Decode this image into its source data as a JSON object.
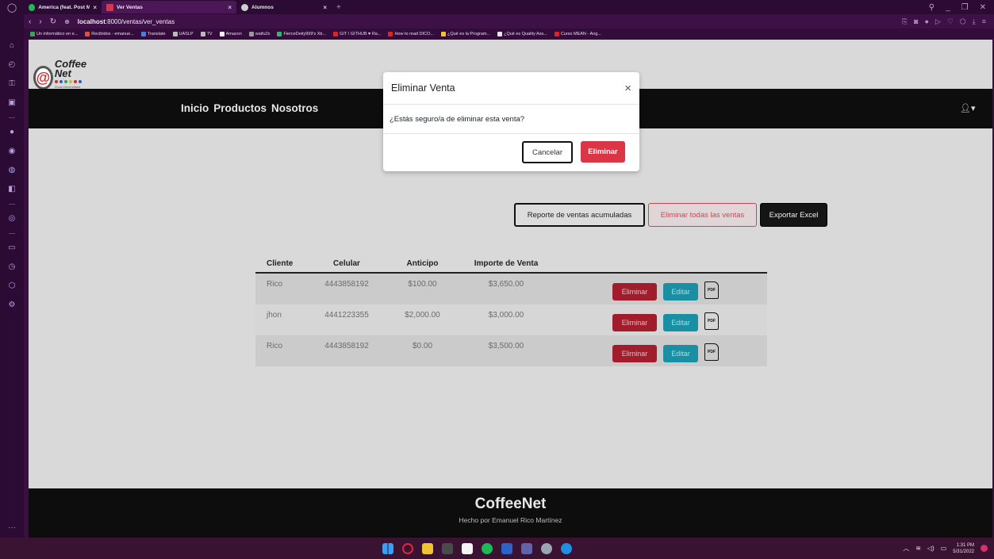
{
  "browser": {
    "tabs": [
      {
        "label": "America (feat. Post Mal",
        "close": "×",
        "color": "#1db954"
      },
      {
        "label": "Ver Ventas",
        "close": "×",
        "color": "#d9364d"
      },
      {
        "label": "Alumnos",
        "close": "×",
        "color": "#7a7a7a"
      }
    ],
    "new_tab": "+",
    "url_host": "localhost",
    "url_path": ":8000/ventas/ver_ventas",
    "bookmarks": [
      {
        "label": "Un informático en e...",
        "color": "#3aa655"
      },
      {
        "label": "Recibidos - emanue...",
        "color": "#e44d3a"
      },
      {
        "label": "Translate",
        "color": "#4c7be3"
      },
      {
        "label": "UASLP",
        "color": "#bbbbbb"
      },
      {
        "label": "TV",
        "color": "#bbbbbb"
      },
      {
        "label": "Amazon",
        "color": "#f0f0f0"
      },
      {
        "label": "waifu2x",
        "color": "#9a9a9a"
      },
      {
        "label": "FierceDeity999's Xb...",
        "color": "#2eb872"
      },
      {
        "label": "GIT / GITHUB ♥ Ra...",
        "color": "#e02424"
      },
      {
        "label": "How to read DICO...",
        "color": "#e02424"
      },
      {
        "label": "¿Qué es la Program...",
        "color": "#f2c230"
      },
      {
        "label": "¿Qué es Quality Ass...",
        "color": "#e6e6e6"
      },
      {
        "label": "Curso MEAN - Ang...",
        "color": "#e02424"
      }
    ]
  },
  "app": {
    "logo_name": "Coffee Net",
    "logo_sub": "Zona Universitaria",
    "logo_sub2": "TODO PARA SUBLIMACIÓN",
    "nav": [
      "Inicio",
      "Productos",
      "Nosotros"
    ],
    "user_icon": "user-icon ▾"
  },
  "actions": {
    "reporte": "Reporte de ventas acumuladas",
    "eliminar_todas": "Eliminar todas las ventas",
    "exportar": "Exportar Excel"
  },
  "table": {
    "headers": [
      "Cliente",
      "Celular",
      "Anticipo",
      "Importe de Venta"
    ],
    "rows": [
      {
        "cliente": "Rico",
        "celular": "4443858192",
        "anticipo": "$100.00",
        "importe": "$3,650.00"
      },
      {
        "cliente": "jhon",
        "celular": "4441223355",
        "anticipo": "$2,000.00",
        "importe": "$3,000.00"
      },
      {
        "cliente": "Rico",
        "celular": "4443858192",
        "anticipo": "$0.00",
        "importe": "$3,500.00"
      }
    ],
    "row_delete": "Eliminar",
    "row_edit": "Editar",
    "pdf_label": "PDF"
  },
  "modal": {
    "title": "Eliminar Venta",
    "close": "×",
    "body": "¿Estás seguro/a de eliminar esta venta?",
    "cancel": "Cancelar",
    "confirm": "Eliminar"
  },
  "footer": {
    "brand": "CoffeeNet",
    "credit": "Hecho por Emanuel Rico Martínez"
  },
  "taskbar": {
    "time": "1:31 PM",
    "date": "5/31/2022"
  },
  "colors": {
    "danger": "#dc3545",
    "info": "#17a2b8",
    "navbar": "#0d0d0d",
    "browser_frame": "#2b0a33"
  }
}
